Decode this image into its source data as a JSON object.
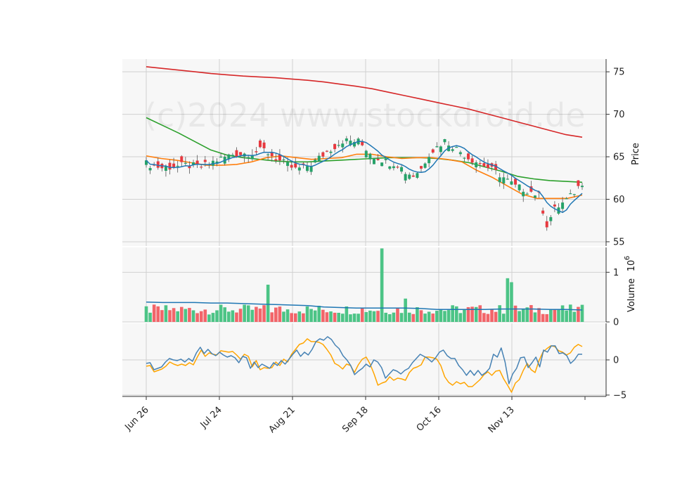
{
  "watermark": "(c)2024 www.stockdroid.de",
  "colors": {
    "up": "#26a269",
    "down": "#e8393f",
    "vol_up": "#4cc486",
    "vol_down": "#f2656a",
    "sma200": "#d62728",
    "sma50": "#2ca02c",
    "sma20": "#ff7f0e",
    "sma10": "#1f77b4",
    "macd": "#4682b4",
    "signal": "#ffa500",
    "panel_bg": "#f7f7f7",
    "grid": "#d0d0d0"
  },
  "chart_data": {
    "type": "candlestick",
    "x_ticks": [
      "Jun 26",
      "Jul 24",
      "Aug 21",
      "Sep 18",
      "Oct 16",
      "Nov 13"
    ],
    "price_panel": {
      "ylabel": "Price",
      "yticks": [
        55,
        60,
        65,
        70,
        75
      ],
      "ylim": [
        54.5,
        76.5
      ],
      "sma200": [
        75.6,
        75.4,
        75.2,
        75.0,
        74.8,
        74.65,
        74.5,
        74.4,
        74.3,
        74.15,
        74.0,
        73.8,
        73.55,
        73.3,
        73.0,
        72.6,
        72.2,
        71.8,
        71.4,
        71.0,
        70.6,
        70.1,
        69.6,
        69.1,
        68.6,
        68.1,
        67.6,
        67.3
      ],
      "sma50": [
        69.6,
        68.7,
        67.8,
        66.8,
        65.8,
        65.2,
        64.9,
        64.7,
        64.5,
        64.4,
        64.4,
        64.5,
        64.6,
        64.7,
        64.8,
        64.9,
        64.9,
        64.9,
        64.8,
        64.6,
        64.3,
        63.8,
        63.3,
        62.7,
        62.4,
        62.2,
        62.1,
        62.0
      ],
      "sma20": [
        65.1,
        64.8,
        64.6,
        64.3,
        64.0,
        64.0,
        64.1,
        64.4,
        64.9,
        65.1,
        64.9,
        64.7,
        64.8,
        64.9,
        65.3,
        65.3,
        65.0,
        64.8,
        64.9,
        64.9,
        64.7,
        64.4,
        63.4,
        62.6,
        61.6,
        60.6,
        60.1,
        60.1,
        60.1,
        60.5
      ]
    },
    "volume_panel": {
      "ylabel": "Volume",
      "scale_label": "10",
      "scale_exp": "6",
      "yticks": [
        0,
        1
      ],
      "ylim": [
        0,
        1.5
      ],
      "volume_ma": [
        0.4,
        0.39,
        0.39,
        0.39,
        0.38,
        0.38,
        0.37,
        0.36,
        0.35,
        0.34,
        0.33,
        0.3,
        0.29,
        0.28,
        0.28,
        0.28,
        0.28,
        0.27,
        0.25,
        0.25,
        0.25,
        0.25,
        0.26,
        0.26,
        0.26,
        0.25,
        0.25,
        0.24
      ]
    },
    "macd_panel": {
      "yticks": [
        -5,
        0
      ],
      "ylim": [
        -5.2,
        5.2
      ],
      "macd": [
        -0.5,
        -0.4,
        -1.4,
        -1.2,
        -1.0,
        -0.3,
        0.2,
        0.0,
        -0.1,
        0.1,
        -0.3,
        0.2,
        -0.2,
        1.0,
        1.8,
        0.9,
        1.5,
        0.9,
        0.6,
        1.1,
        0.7,
        0.4,
        0.6,
        0.3,
        -0.4,
        0.5,
        0.3,
        -1.2,
        -0.3,
        -1.1,
        -0.6,
        -0.9,
        -1.2,
        -0.4,
        -0.8,
        -0.1,
        -0.6,
        0.1,
        0.8,
        1.4,
        0.5,
        1.1,
        0.7,
        1.5,
        2.6,
        3.0,
        2.8,
        3.3,
        2.9,
        2.1,
        1.6,
        0.6,
        0.0,
        -0.8,
        -2.1,
        -1.6,
        -1.2,
        -0.6,
        -1.0,
        0.0,
        -0.3,
        -1.1,
        -2.6,
        -2.0,
        -1.4,
        -1.6,
        -2.0,
        -1.5,
        -1.2,
        -0.4,
        0.2,
        0.8,
        0.5,
        0.2,
        -0.3,
        0.3,
        1.1,
        1.4,
        0.6,
        0.2,
        0.2,
        -0.8,
        -1.4,
        -2.2,
        -1.5,
        -2.2,
        -1.5,
        -2.2,
        -1.8,
        -1.2,
        0.8,
        0.4,
        1.7,
        -0.3,
        -3.4,
        -2.0,
        -1.2,
        0.3,
        0.4,
        -1.1,
        -0.4,
        0.4,
        -1.0,
        1.4,
        1.1,
        2.0,
        2.0,
        0.9,
        1.0,
        0.6,
        -0.5,
        0.0,
        0.8,
        0.8
      ],
      "signal": [
        -0.9,
        -0.8,
        -1.7,
        -1.5,
        -1.3,
        -0.9,
        -0.3,
        -0.6,
        -0.8,
        -0.6,
        -0.8,
        -0.4,
        -0.7,
        0.4,
        1.4,
        0.5,
        1.0,
        0.8,
        0.7,
        1.3,
        1.2,
        1.1,
        1.2,
        0.7,
        0.1,
        0.8,
        0.5,
        -1.0,
        -0.1,
        -1.4,
        -1.1,
        -1.2,
        -1.1,
        -0.3,
        -0.8,
        0.1,
        -0.3,
        0.8,
        1.5,
        2.2,
        2.4,
        3.0,
        2.6,
        2.6,
        2.5,
        2.2,
        1.5,
        0.7,
        -0.5,
        -0.8,
        -1.3,
        -0.6,
        -0.8,
        -1.8,
        -0.7,
        0.1,
        0.4,
        -0.6,
        -2.0,
        -3.6,
        -3.3,
        -3.1,
        -2.4,
        -2.9,
        -2.6,
        -2.7,
        -2.9,
        -1.8,
        -1.2,
        -1.0,
        -0.7,
        0.4,
        0.4,
        0.3,
        0.1,
        -0.8,
        -2.4,
        -3.2,
        -3.6,
        -3.1,
        -3.4,
        -3.2,
        -3.8,
        -3.8,
        -3.3,
        -2.8,
        -2.1,
        -1.7,
        -2.2,
        -1.6,
        -1.5,
        -2.7,
        -3.6,
        -4.6,
        -3.3,
        -2.8,
        -1.5,
        -0.5,
        -1.4,
        -1.8,
        -0.1,
        1.1,
        1.6,
        2.0,
        1.9,
        1.3,
        1.1,
        0.7,
        1.0,
        1.8,
        2.2,
        1.9
      ]
    }
  }
}
